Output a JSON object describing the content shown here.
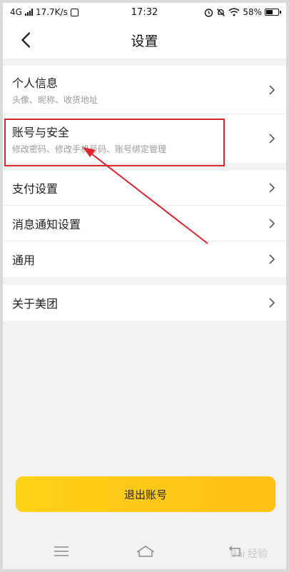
{
  "status_bar": {
    "network": "4G",
    "speed": "17.7K/s",
    "time": "17:32",
    "battery": "58%",
    "icons": [
      "signal-icon",
      "notification-app-icon",
      "alarm-icon",
      "mute-icon",
      "wifi-icon",
      "battery-icon"
    ]
  },
  "header": {
    "title": "设置",
    "back_icon": "chevron-left-icon"
  },
  "groups": [
    {
      "items": [
        {
          "title": "个人信息",
          "subtitle": "头像、昵称、收货地址"
        },
        {
          "title": "账号与安全",
          "subtitle": "修改密码、修改手机号码、账号绑定管理"
        }
      ]
    },
    {
      "items": [
        {
          "title": "支付设置"
        },
        {
          "title": "消息通知设置"
        },
        {
          "title": "通用"
        }
      ]
    },
    {
      "items": [
        {
          "title": "关于美团"
        }
      ]
    }
  ],
  "annotation": {
    "highlight_color": "#d9262c",
    "arrow_color": "#d9262c"
  },
  "logout": {
    "label": "退出账号",
    "color": "#ffc814"
  },
  "bottom_nav": {
    "icons": [
      "menu-icon",
      "home-icon",
      "back-icon"
    ]
  },
  "watermark": {
    "text": "Bai 经验"
  }
}
